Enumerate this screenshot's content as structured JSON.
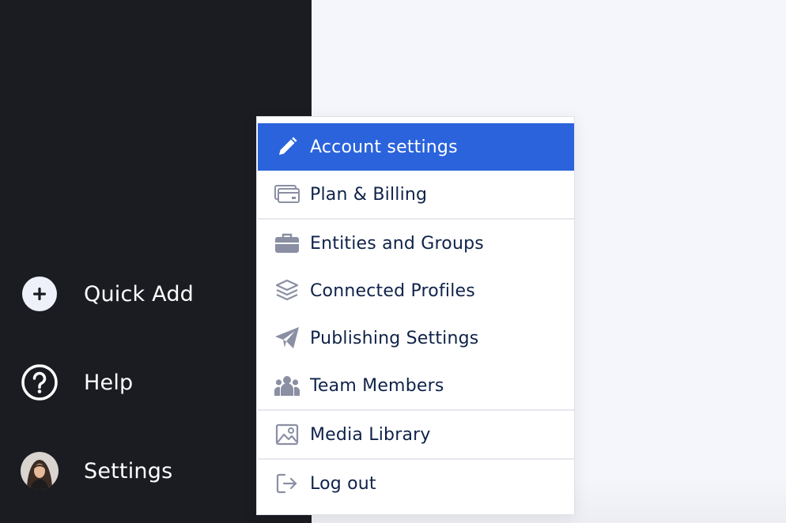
{
  "sidebar": {
    "items": [
      {
        "label": "Quick Add",
        "icon": "plus-circle-icon"
      },
      {
        "label": "Help",
        "icon": "question-circle-icon"
      },
      {
        "label": "Settings",
        "icon": "avatar"
      }
    ]
  },
  "settings_menu": {
    "items": [
      {
        "label": "Account settings",
        "icon": "pencil-icon",
        "active": true
      },
      {
        "label": "Plan & Billing",
        "icon": "credit-card-icon"
      },
      {
        "label": "Entities and Groups",
        "icon": "briefcase-icon"
      },
      {
        "label": "Connected Profiles",
        "icon": "layers-icon"
      },
      {
        "label": "Publishing Settings",
        "icon": "paper-plane-icon"
      },
      {
        "label": "Team Members",
        "icon": "users-icon"
      },
      {
        "label": "Media Library",
        "icon": "image-icon"
      },
      {
        "label": "Log out",
        "icon": "logout-icon"
      }
    ]
  },
  "colors": {
    "sidebar_bg": "#1b1c22",
    "accent": "#2a63dc",
    "menu_text": "#0f2249",
    "icon_gray": "#8a8fa3"
  }
}
